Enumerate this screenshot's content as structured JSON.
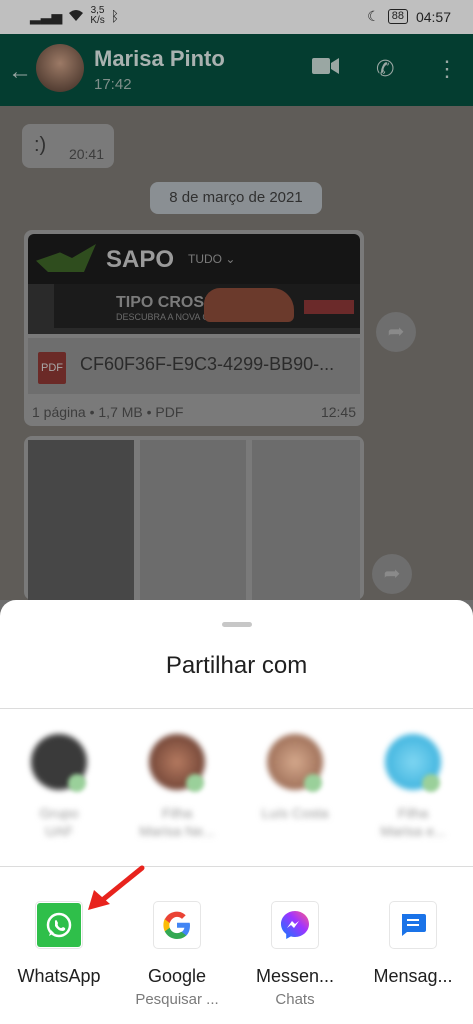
{
  "status_bar": {
    "speed_value": "3,5",
    "speed_unit": "K/s",
    "battery": "88",
    "time": "04:57"
  },
  "header": {
    "contact_name": "Marisa Pinto",
    "last_seen": "17:42"
  },
  "chat": {
    "message1_text": ":)",
    "message1_time": "20:41",
    "date_pill": "8 de março de 2021",
    "doc_preview": {
      "site_logo": "SAPO",
      "site_menu": "TUDO ⌄",
      "ad_title": "TIPO CROSS",
      "ad_subtitle": "DESCUBRA A NOVA GAMA"
    },
    "doc_icon_label": "PDF",
    "doc_name": "CF60F36F-E9C3-4299-BB90-...",
    "doc_meta": "1 página • 1,7 MB • PDF",
    "doc_time": "12:45"
  },
  "share_sheet": {
    "title": "Partilhar com",
    "contacts": [
      {
        "name_line1": "Grupo",
        "name_line2": "UAF",
        "color": "#3a3a3a"
      },
      {
        "name_line1": "Filha",
        "name_line2": "Marisa Ne...",
        "color": "#8a4a3a"
      },
      {
        "name_line1": "Luís Costa",
        "name_line2": "",
        "color": "#b58870"
      },
      {
        "name_line1": "Filha",
        "name_line2": "Marisa e...",
        "color": "#39b7e0"
      }
    ],
    "apps": [
      {
        "label": "WhatsApp",
        "sub": "",
        "icon": "whatsapp-icon"
      },
      {
        "label": "Google",
        "sub": "Pesquisar ...",
        "icon": "google-icon"
      },
      {
        "label": "Messen...",
        "sub": "Chats",
        "icon": "messenger-icon"
      },
      {
        "label": "Mensag...",
        "sub": "",
        "icon": "messages-icon"
      }
    ]
  },
  "colors": {
    "annotation_arrow": "#e8231d",
    "whatsapp_green": "#25d366"
  }
}
